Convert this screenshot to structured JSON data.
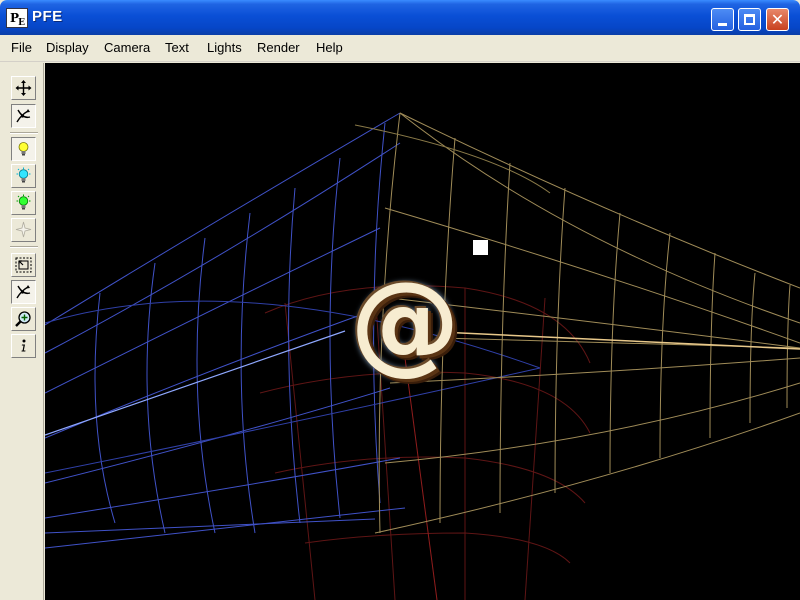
{
  "window": {
    "title": "PFE",
    "icon_text": "P",
    "icon_sub": "E"
  },
  "menu": {
    "items": [
      "File",
      "Display",
      "Camera",
      "Text",
      "Lights",
      "Render",
      "Help"
    ]
  },
  "toolbar": {
    "tools": [
      {
        "icon": "move-icon",
        "pressed": false
      },
      {
        "icon": "rotate-icon",
        "pressed": true
      },
      {
        "icon": "light-yellow-icon",
        "pressed": true
      },
      {
        "icon": "light-cyan-icon",
        "pressed": false
      },
      {
        "icon": "light-green-icon",
        "pressed": false
      },
      {
        "icon": "light-disabled-icon",
        "pressed": false
      },
      {
        "icon": "region-zoom-icon",
        "pressed": false
      },
      {
        "icon": "rotate-camera-icon",
        "pressed": true
      },
      {
        "icon": "zoom-icon",
        "pressed": false
      },
      {
        "icon": "info-icon",
        "pressed": false
      }
    ]
  },
  "viewport": {
    "text_glyph": "@",
    "colors": {
      "background": "#000000",
      "wire_blue": "#4b5ccf",
      "wire_gold": "#b8a064",
      "wire_red": "#7a1f1f",
      "glyph_face": "#f7ecd0"
    }
  }
}
